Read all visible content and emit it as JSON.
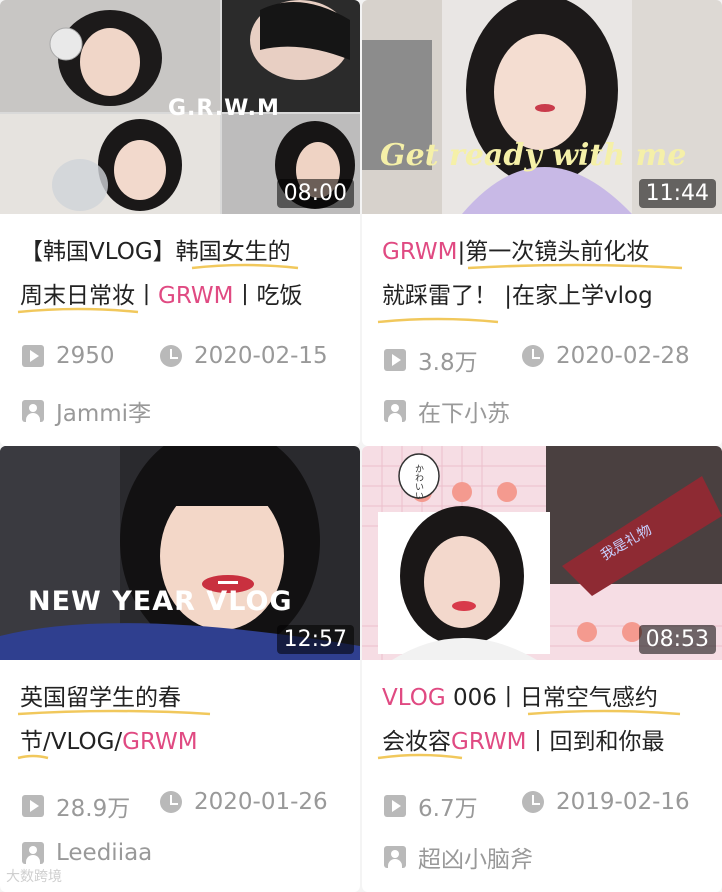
{
  "cards": [
    {
      "duration": "08:00",
      "overlay": "G.R.W.M",
      "title_a": "【韩国VLOG】韩国女生的",
      "title_b1": "周末日常妆丨",
      "title_b_hl": "GRWM",
      "title_b2": "丨吃饭",
      "views": "2950",
      "date": "2020-02-15",
      "author": "Jammi李"
    },
    {
      "duration": "11:44",
      "overlay": "Get ready with me",
      "title_a_hl": "GRWM",
      "title_a": "|第一次镜头前化妆",
      "title_b": "就踩雷了！ |在家上学vlog",
      "views": "3.8万",
      "date": "2020-02-28",
      "author": "在下小苏"
    },
    {
      "duration": "12:57",
      "overlay": "NEW YEAR VLOG",
      "title_a": "英国留学生的春",
      "title_b1": "节/VLOG/",
      "title_b_hl": "GRWM",
      "views": "28.9万",
      "date": "2020-01-26",
      "author": "Leediiaa"
    },
    {
      "duration": "08:53",
      "sticker": "かわいい",
      "banner": "我是礼物",
      "title_a_hl": "VLOG",
      "title_a": " 006丨日常空气感约",
      "title_b1": "会妆容",
      "title_b_hl": "GRWM",
      "title_b2": "丨回到和你最",
      "views": "6.7万",
      "date": "2019-02-16",
      "author": "超凶小脑斧"
    }
  ],
  "watermark": "大数跨境",
  "colors": {
    "highlight": "#e04a82",
    "underline": "#f1c85c",
    "meta": "#999999"
  }
}
